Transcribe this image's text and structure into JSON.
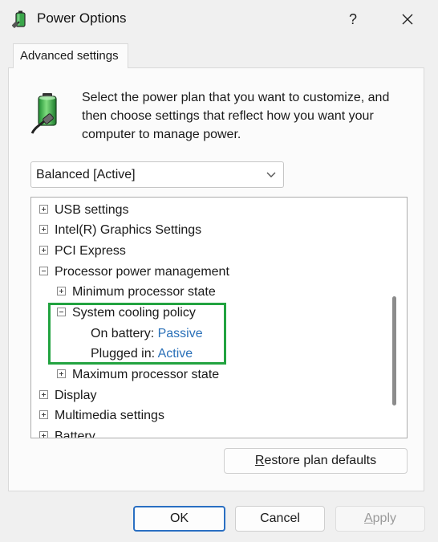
{
  "window": {
    "title": "Power Options",
    "help_label": "?",
    "close_label": "✕"
  },
  "tabs": [
    {
      "label": "Advanced settings"
    }
  ],
  "description": "Select the power plan that you want to customize, and then choose settings that reflect how you want your computer to manage power.",
  "plan_select": {
    "value": "Balanced [Active]"
  },
  "tree": {
    "items": [
      {
        "label": "USB settings"
      },
      {
        "label": "Intel(R) Graphics Settings"
      },
      {
        "label": "PCI Express"
      },
      {
        "label": "Processor power management"
      },
      {
        "label": "Minimum processor state"
      },
      {
        "label": "System cooling policy"
      },
      {
        "label": "On battery:",
        "value": "Passive"
      },
      {
        "label": "Plugged in:",
        "value": "Active"
      },
      {
        "label": "Maximum processor state"
      },
      {
        "label": "Display"
      },
      {
        "label": "Multimedia settings"
      },
      {
        "label": "Battery"
      }
    ]
  },
  "buttons": {
    "restore_mnemonic": "R",
    "restore_rest": "estore plan defaults",
    "ok": "OK",
    "cancel": "Cancel",
    "apply_mnemonic": "A",
    "apply_rest": "pply"
  },
  "colors": {
    "highlight": "#22a340",
    "link": "#2a70b8",
    "focus": "#2a6fc2"
  },
  "icons": {
    "app": "power-options-icon",
    "battery": "battery-plug-icon",
    "dropdown": "chevron-down-icon"
  }
}
